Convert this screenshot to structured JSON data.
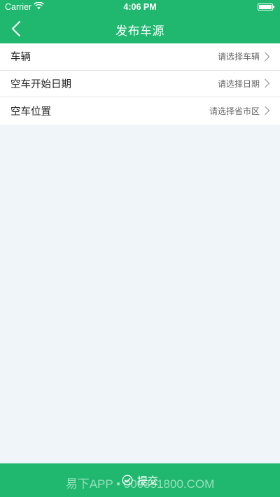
{
  "status_bar": {
    "carrier": "Carrier",
    "time": "4:06 PM"
  },
  "header": {
    "title": "发布车源"
  },
  "form": {
    "rows": [
      {
        "label": "车辆",
        "value": "请选择车辆"
      },
      {
        "label": "空车开始日期",
        "value": "请选择日期"
      },
      {
        "label": "空车位置",
        "value": "请选择省市区"
      }
    ]
  },
  "footer": {
    "submit_label": "提交"
  },
  "watermark": {
    "text": "易下APP • 000391800.COM"
  },
  "colors": {
    "accent": "#1fb86e",
    "background": "#f0f5f9"
  }
}
